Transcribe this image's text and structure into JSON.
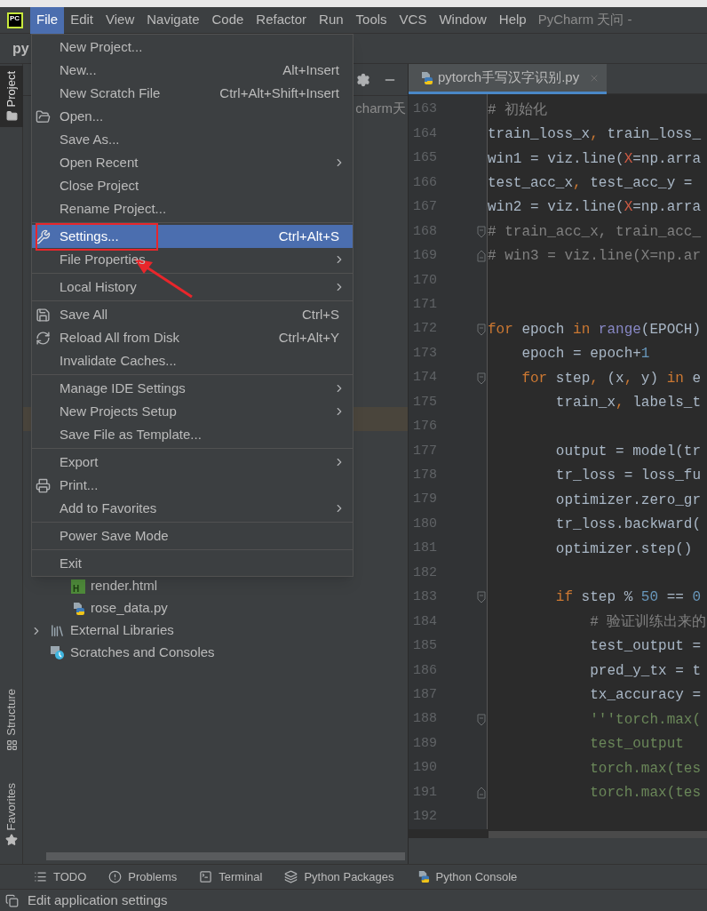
{
  "menu_bar": {
    "logo_text": "PC",
    "items": [
      {
        "label": "File",
        "selected": true
      },
      {
        "label": "Edit",
        "selected": false
      },
      {
        "label": "View",
        "selected": false
      },
      {
        "label": "Navigate",
        "selected": false
      },
      {
        "label": "Code",
        "selected": false
      },
      {
        "label": "Refactor",
        "selected": false
      },
      {
        "label": "Run",
        "selected": false
      },
      {
        "label": "Tools",
        "selected": false
      },
      {
        "label": "VCS",
        "selected": false
      },
      {
        "label": "Window",
        "selected": false
      },
      {
        "label": "Help",
        "selected": false
      }
    ],
    "title": "PyCharm 天问 -"
  },
  "navigation_bar": {
    "project": "py"
  },
  "left_tool_strip": [
    {
      "label": "Project",
      "kind": "project",
      "selected": true
    },
    {
      "label": "Structure",
      "kind": "structure",
      "selected": false
    },
    {
      "label": "Favorites",
      "kind": "favorites",
      "selected": false
    }
  ],
  "project_panel": {
    "path": "charm天",
    "tree": [
      {
        "label": "render.html",
        "kind": "html",
        "icon_text": "H"
      },
      {
        "label": "rose_data.py",
        "kind": "python"
      },
      {
        "label": "External Libraries",
        "kind": "libraries",
        "expanded": false
      },
      {
        "label": "Scratches and Consoles",
        "kind": "scratches"
      }
    ]
  },
  "file_menu": {
    "groups": [
      [
        {
          "label": "New Project...",
          "kind": "plain",
          "submenu": false,
          "selected": false,
          "marked": false
        },
        {
          "label": "New...",
          "kind": "plain",
          "shortcut": "Alt+Insert",
          "submenu": false,
          "selected": false,
          "marked": false
        },
        {
          "label": "New Scratch File",
          "kind": "plain",
          "shortcut": "Ctrl+Alt+Shift+Insert",
          "submenu": false,
          "selected": false,
          "marked": false
        },
        {
          "label": "Open...",
          "kind": "open",
          "submenu": false,
          "selected": false,
          "marked": false
        },
        {
          "label": "Save As...",
          "kind": "plain",
          "submenu": false,
          "selected": false,
          "marked": false
        },
        {
          "label": "Open Recent",
          "kind": "plain",
          "submenu": true,
          "selected": false,
          "marked": false
        },
        {
          "label": "Close Project",
          "kind": "plain",
          "submenu": false,
          "selected": false,
          "marked": false
        },
        {
          "label": "Rename Project...",
          "kind": "plain",
          "submenu": false,
          "selected": false,
          "marked": false
        }
      ],
      [
        {
          "label": "Settings...",
          "kind": "settings",
          "shortcut": "Ctrl+Alt+S",
          "submenu": false,
          "selected": true,
          "marked": true
        },
        {
          "label": "File Properties",
          "kind": "plain",
          "submenu": true,
          "selected": false,
          "marked": false
        }
      ],
      [
        {
          "label": "Local History",
          "kind": "plain",
          "submenu": true,
          "selected": false,
          "marked": false
        }
      ],
      [
        {
          "label": "Save All",
          "kind": "save",
          "shortcut": "Ctrl+S",
          "submenu": false,
          "selected": false,
          "marked": false
        },
        {
          "label": "Reload All from Disk",
          "kind": "reload",
          "shortcut": "Ctrl+Alt+Y",
          "submenu": false,
          "selected": false,
          "marked": false
        },
        {
          "label": "Invalidate Caches...",
          "kind": "plain",
          "submenu": false,
          "selected": false,
          "marked": false
        }
      ],
      [
        {
          "label": "Manage IDE Settings",
          "kind": "plain",
          "submenu": true,
          "selected": false,
          "marked": false
        },
        {
          "label": "New Projects Setup",
          "kind": "plain",
          "submenu": true,
          "selected": false,
          "marked": false
        },
        {
          "label": "Save File as Template...",
          "kind": "plain",
          "submenu": false,
          "selected": false,
          "marked": false
        }
      ],
      [
        {
          "label": "Export",
          "kind": "plain",
          "submenu": true,
          "selected": false,
          "marked": false
        },
        {
          "label": "Print...",
          "kind": "print",
          "submenu": false,
          "selected": false,
          "marked": false
        },
        {
          "label": "Add to Favorites",
          "kind": "plain",
          "submenu": true,
          "selected": false,
          "marked": false
        }
      ],
      [
        {
          "label": "Power Save Mode",
          "kind": "plain",
          "submenu": false,
          "selected": false,
          "marked": false
        }
      ],
      [
        {
          "label": "Exit",
          "kind": "plain",
          "submenu": false,
          "selected": false,
          "marked": false
        }
      ]
    ]
  },
  "editor": {
    "tabs": [
      {
        "label": "pytorch手写汉字识别.py",
        "selected": true
      }
    ],
    "lines": [
      {
        "number": "163",
        "tokens": [
          {
            "t": "# 初始化",
            "kind": "comment"
          }
        ]
      },
      {
        "number": "164",
        "tokens": [
          {
            "t": "train_loss_x",
            "kind": "plain"
          },
          {
            "t": ",",
            "kind": "keyword"
          },
          {
            "t": " train_loss_",
            "kind": "plain"
          }
        ]
      },
      {
        "number": "165",
        "tokens": [
          {
            "t": "win1 = viz.line(",
            "kind": "plain"
          },
          {
            "t": "X",
            "kind": "param"
          },
          {
            "t": "=np.arra",
            "kind": "plain"
          }
        ]
      },
      {
        "number": "166",
        "tokens": [
          {
            "t": "test_acc_x",
            "kind": "plain"
          },
          {
            "t": ",",
            "kind": "keyword"
          },
          {
            "t": " test_acc_y =",
            "kind": "plain"
          }
        ]
      },
      {
        "number": "167",
        "tokens": [
          {
            "t": "win2 = viz.line(",
            "kind": "plain"
          },
          {
            "t": "X",
            "kind": "param"
          },
          {
            "t": "=np.arra",
            "kind": "plain"
          }
        ]
      },
      {
        "number": "168",
        "fold_start": true,
        "fold_end": false,
        "tokens": [
          {
            "t": "# train_acc_x, train_acc_",
            "kind": "comment"
          }
        ]
      },
      {
        "number": "169",
        "fold_start": false,
        "fold_end": true,
        "tokens": [
          {
            "t": "# win3 = viz.line(X=np.ar",
            "kind": "comment"
          }
        ]
      },
      {
        "number": "170"
      },
      {
        "number": "171"
      },
      {
        "number": "172",
        "fold_start": true,
        "fold_end": false,
        "tokens": [
          {
            "t": "for",
            "kind": "keyword"
          },
          {
            "t": " epoch ",
            "kind": "plain"
          },
          {
            "t": "in",
            "kind": "keyword"
          },
          {
            "t": " range",
            "kind": "builtin"
          },
          {
            "t": "(EPOCH)",
            "kind": "plain"
          }
        ]
      },
      {
        "number": "173",
        "tokens": [
          {
            "t": "    epoch = epoch+",
            "kind": "plain"
          },
          {
            "t": "1",
            "kind": "number"
          }
        ]
      },
      {
        "number": "174",
        "fold_start": true,
        "fold_end": false,
        "tokens": [
          {
            "t": "    for",
            "kind": "keyword"
          },
          {
            "t": " step",
            "kind": "plain"
          },
          {
            "t": ",",
            "kind": "keyword"
          },
          {
            "t": " (x",
            "kind": "plain"
          },
          {
            "t": ",",
            "kind": "keyword"
          },
          {
            "t": " y) ",
            "kind": "plain"
          },
          {
            "t": "in",
            "kind": "keyword"
          },
          {
            "t": " e",
            "kind": "plain"
          }
        ]
      },
      {
        "number": "175",
        "tokens": [
          {
            "t": "        train_x",
            "kind": "plain"
          },
          {
            "t": ",",
            "kind": "keyword"
          },
          {
            "t": " labels_t",
            "kind": "plain"
          }
        ]
      },
      {
        "number": "176"
      },
      {
        "number": "177",
        "tokens": [
          {
            "t": "        output = model(tr",
            "kind": "plain"
          }
        ]
      },
      {
        "number": "178",
        "tokens": [
          {
            "t": "        tr_loss = loss_fu",
            "kind": "plain"
          }
        ]
      },
      {
        "number": "179",
        "tokens": [
          {
            "t": "        optimizer.zero_gr",
            "kind": "plain"
          }
        ]
      },
      {
        "number": "180",
        "tokens": [
          {
            "t": "        tr_loss.backward(",
            "kind": "plain"
          }
        ]
      },
      {
        "number": "181",
        "tokens": [
          {
            "t": "        optimizer.step()",
            "kind": "plain"
          }
        ]
      },
      {
        "number": "182"
      },
      {
        "number": "183",
        "fold_start": true,
        "fold_end": false,
        "tokens": [
          {
            "t": "        if",
            "kind": "keyword"
          },
          {
            "t": " step % ",
            "kind": "plain"
          },
          {
            "t": "50",
            "kind": "number"
          },
          {
            "t": " == ",
            "kind": "plain"
          },
          {
            "t": "0",
            "kind": "number"
          }
        ]
      },
      {
        "number": "184",
        "tokens": [
          {
            "t": "            # 验证训练出来的",
            "kind": "comment"
          }
        ]
      },
      {
        "number": "185",
        "tokens": [
          {
            "t": "            test_output =",
            "kind": "plain"
          }
        ]
      },
      {
        "number": "186",
        "tokens": [
          {
            "t": "            pred_y_tx = t",
            "kind": "plain"
          }
        ]
      },
      {
        "number": "187",
        "tokens": [
          {
            "t": "            tx_accuracy =",
            "kind": "plain"
          }
        ]
      },
      {
        "number": "188",
        "fold_start": true,
        "fold_end": false,
        "tokens": [
          {
            "t": "            '''torch.max(",
            "kind": "string"
          }
        ]
      },
      {
        "number": "189",
        "tokens": [
          {
            "t": "            test_output",
            "kind": "string"
          }
        ]
      },
      {
        "number": "190",
        "tokens": [
          {
            "t": "            torch.max(tes",
            "kind": "string"
          }
        ]
      },
      {
        "number": "191",
        "fold_start": false,
        "fold_end": true,
        "tokens": [
          {
            "t": "            torch.max(tes",
            "kind": "string"
          }
        ]
      },
      {
        "number": "192"
      }
    ]
  },
  "tool_window_bar": [
    {
      "label": "TODO",
      "kind": "todo"
    },
    {
      "label": "Problems",
      "kind": "problems"
    },
    {
      "label": "Terminal",
      "kind": "terminal"
    },
    {
      "label": "Python Packages",
      "kind": "packages"
    },
    {
      "label": "Python Console",
      "kind": "console"
    }
  ],
  "status_bar": {
    "message": "Edit application settings"
  }
}
